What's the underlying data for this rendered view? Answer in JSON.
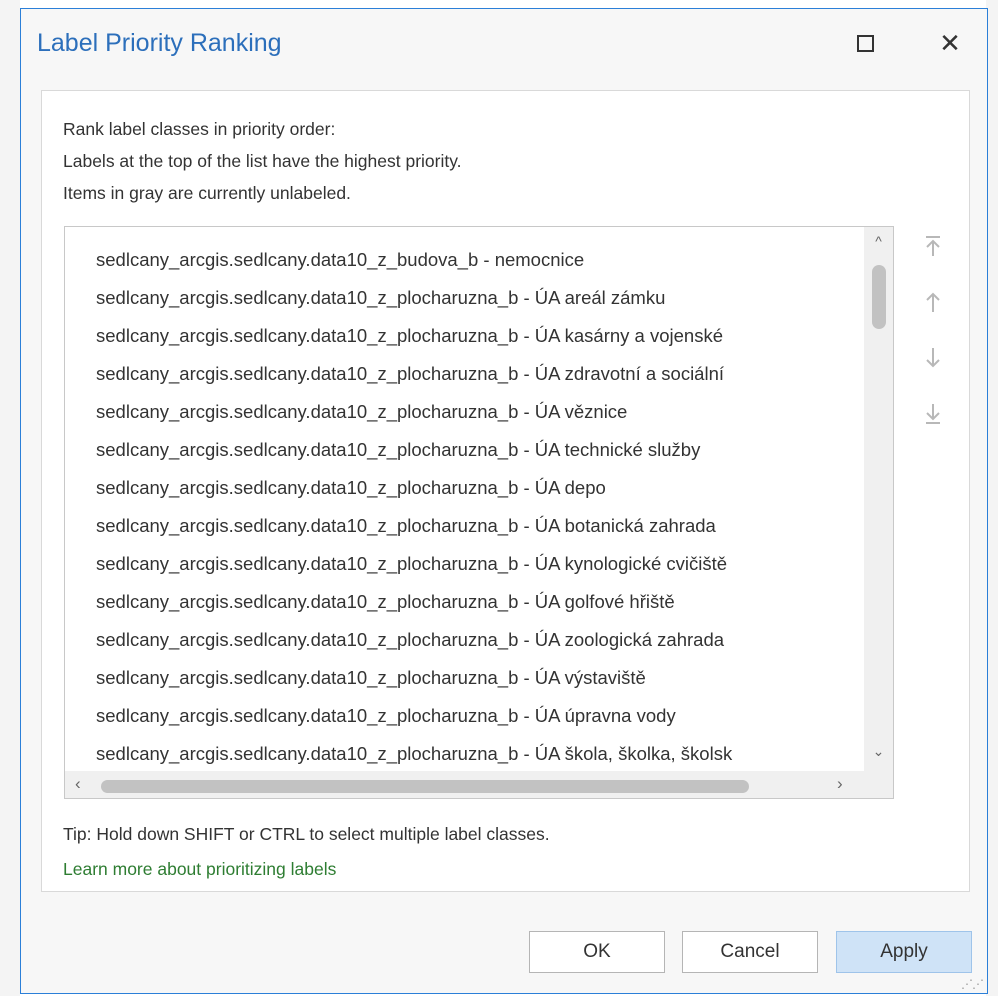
{
  "dialog": {
    "title": "Label Priority Ranking",
    "maximize_icon": "maximize-icon",
    "close_icon": "close-icon",
    "close_glyph": "✕"
  },
  "instructions": [
    "Rank label classes in priority order:",
    "Labels at the top of the list have the highest priority.",
    "Items in gray are currently unlabeled."
  ],
  "label_classes": [
    "sedlcany_arcgis.sedlcany.data10_z_budova_b - nemocnice",
    "sedlcany_arcgis.sedlcany.data10_z_plocharuzna_b - ÚA areál zámku",
    "sedlcany_arcgis.sedlcany.data10_z_plocharuzna_b - ÚA kasárny a vojenské",
    "sedlcany_arcgis.sedlcany.data10_z_plocharuzna_b - ÚA zdravotní a sociální",
    "sedlcany_arcgis.sedlcany.data10_z_plocharuzna_b - ÚA věznice",
    "sedlcany_arcgis.sedlcany.data10_z_plocharuzna_b - ÚA technické služby",
    "sedlcany_arcgis.sedlcany.data10_z_plocharuzna_b - ÚA depo",
    "sedlcany_arcgis.sedlcany.data10_z_plocharuzna_b - ÚA botanická zahrada",
    "sedlcany_arcgis.sedlcany.data10_z_plocharuzna_b - ÚA kynologické cvičiště",
    "sedlcany_arcgis.sedlcany.data10_z_plocharuzna_b - ÚA golfové hřiště",
    "sedlcany_arcgis.sedlcany.data10_z_plocharuzna_b - ÚA zoologická zahrada",
    "sedlcany_arcgis.sedlcany.data10_z_plocharuzna_b - ÚA výstaviště",
    "sedlcany_arcgis.sedlcany.data10_z_plocharuzna_b - ÚA úpravna vody",
    "sedlcany_arcgis.sedlcany.data10_z_plocharuzna_b - ÚA škola, školka, školsk"
  ],
  "side_controls": {
    "move_top_icon": "move-to-top-icon",
    "move_up_icon": "move-up-icon",
    "move_down_icon": "move-down-icon",
    "move_bottom_icon": "move-to-bottom-icon"
  },
  "tip": "Tip: Hold down SHIFT or CTRL to select multiple label classes.",
  "learn_more": "Learn more about prioritizing labels",
  "buttons": {
    "ok": "OK",
    "cancel": "Cancel",
    "apply": "Apply"
  },
  "colors": {
    "title": "#2c6fbb",
    "link": "#2e7d32",
    "apply_bg": "#cfe3f7",
    "border_accent": "#2b7fd8"
  }
}
